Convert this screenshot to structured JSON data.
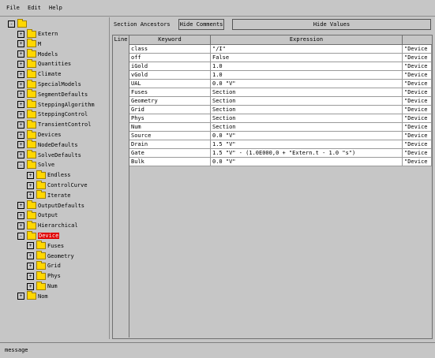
{
  "menu": {
    "file": "File",
    "edit": "Edit",
    "help": "Help"
  },
  "tree": {
    "root_label": "",
    "nodes": [
      {
        "label": "Extern",
        "toggle": "+"
      },
      {
        "label": "M",
        "toggle": "+"
      },
      {
        "label": "Models",
        "toggle": "+"
      },
      {
        "label": "Quantities",
        "toggle": "+"
      },
      {
        "label": "Climate",
        "toggle": "+"
      },
      {
        "label": "SpecialModels",
        "toggle": "+"
      },
      {
        "label": "SegmentDefaults",
        "toggle": "+"
      },
      {
        "label": "SteppingAlgorithm",
        "toggle": "+"
      },
      {
        "label": "SteppingControl",
        "toggle": "+"
      },
      {
        "label": "TransientControl",
        "toggle": "+"
      },
      {
        "label": "Devices",
        "toggle": "+"
      },
      {
        "label": "NodeDefaults",
        "toggle": "+"
      },
      {
        "label": "SolveDefaults",
        "toggle": "+"
      },
      {
        "label": "Solve",
        "toggle": "-"
      },
      {
        "label": "Endless",
        "toggle": "+"
      },
      {
        "label": "ControlCurve",
        "toggle": "+"
      },
      {
        "label": "Iterate",
        "toggle": "+"
      },
      {
        "label": "OutputDefaults",
        "toggle": "+"
      },
      {
        "label": "Output",
        "toggle": "+"
      },
      {
        "label": "Hierarchical",
        "toggle": "+"
      },
      {
        "label": "Device",
        "toggle": "-",
        "selected": true
      },
      {
        "label": "Fuses",
        "toggle": "+"
      },
      {
        "label": "Geometry",
        "toggle": "+"
      },
      {
        "label": "Grid",
        "toggle": "+"
      },
      {
        "label": "Phys",
        "toggle": "+"
      },
      {
        "label": "Num",
        "toggle": "+"
      },
      {
        "label": "Nom",
        "toggle": "+"
      }
    ]
  },
  "toolbar": {
    "label": "Section Ancestors",
    "hide_comments": "Hide Comments",
    "hide_values": "Hide Values"
  },
  "table": {
    "headers": {
      "line": "Line",
      "keyword": "Keyword",
      "expression": "Expression"
    },
    "rows": [
      {
        "keyword": "class",
        "expression": "\"/I\"",
        "origin": "\"Device"
      },
      {
        "keyword": "off",
        "expression": "False",
        "origin": "\"Device"
      },
      {
        "keyword": "iGold",
        "expression": "1.0",
        "origin": "\"Device"
      },
      {
        "keyword": "vGold",
        "expression": "1.0",
        "origin": "\"Device"
      },
      {
        "keyword": "UAL",
        "expression": "0.0 \"V\"",
        "origin": "\"Device"
      },
      {
        "keyword": "Fuses",
        "expression": "Section",
        "origin": "\"Device"
      },
      {
        "keyword": "Geometry",
        "expression": "Section",
        "origin": "\"Device"
      },
      {
        "keyword": "Grid",
        "expression": "Section",
        "origin": "\"Device"
      },
      {
        "keyword": "Phys",
        "expression": "Section",
        "origin": "\"Device"
      },
      {
        "keyword": "Num",
        "expression": "Section",
        "origin": "\"Device"
      },
      {
        "keyword": "Source",
        "expression": "0.0 \"V\"",
        "origin": "\"Device"
      },
      {
        "keyword": "Drain",
        "expression": "1.5 \"V\"",
        "origin": "\"Device"
      },
      {
        "keyword": "Gate",
        "expression": "1.5 \"V\" - (1.0E000,0 + \"Extern.t - 1.0 \"s\")",
        "origin": "\"Device"
      },
      {
        "keyword": "Bulk",
        "expression": "0.0 \"V\"",
        "origin": "\"Device"
      }
    ]
  },
  "status": {
    "text": "message"
  }
}
